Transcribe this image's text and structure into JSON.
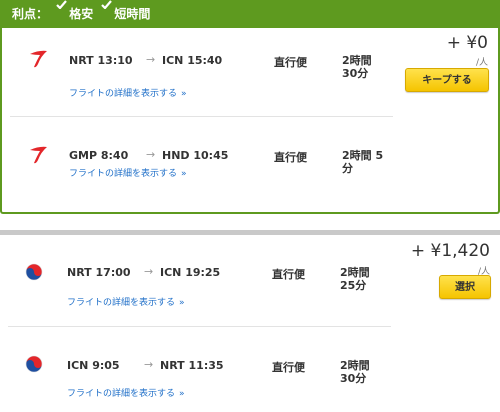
{
  "benefits": {
    "label": "利点：",
    "items": [
      "格安",
      "短時間"
    ]
  },
  "offers": [
    {
      "price": "+ ¥0",
      "per": "/人",
      "button": "キープする",
      "legs": [
        {
          "airline": "Asiana (red wing logo)",
          "dep": "NRT 13:10",
          "arr": "ICN 15:40",
          "stops": "直行便",
          "duration": "2時間 30分",
          "details": "フライトの詳細を表示する"
        },
        {
          "airline": "Asiana (red wing logo)",
          "dep": "GMP 8:40",
          "arr": "HND 10:45",
          "stops": "直行便",
          "duration": "2時間 5分",
          "details": "フライトの詳細を表示する"
        }
      ]
    },
    {
      "price": "+ ¥1,420",
      "per": "/人",
      "button": "選択",
      "legs": [
        {
          "airline": "Korean Air (taegeuk logo)",
          "dep": "NRT 17:00",
          "arr": "ICN 19:25",
          "stops": "直行便",
          "duration": "2時間 25分",
          "details": "フライトの詳細を表示する"
        },
        {
          "airline": "Korean Air (taegeuk logo)",
          "dep": "ICN 9:05",
          "arr": "NRT 11:35",
          "stops": "直行便",
          "duration": "2時間 30分",
          "details": "フライトの詳細を表示する"
        }
      ]
    }
  ],
  "colors": {
    "selected_frame": "#5e9a1f",
    "link": "#1f6fc8",
    "button_yellow": "#f5c400",
    "asiana_red": "#e3262a",
    "korean_blue": "#1f4fa0"
  }
}
